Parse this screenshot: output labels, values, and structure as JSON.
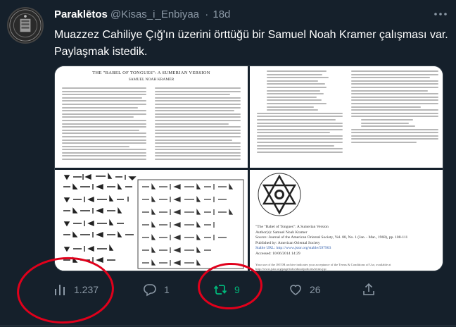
{
  "tweet": {
    "author_name": "Paraklētos",
    "author_handle": "@Kisas_i_Enbiyaa",
    "separator": "·",
    "time": "18d",
    "text": "Muazzez Cahiliye Çığ'ın üzerini örttüğü bir Samuel Noah Kramer çalışması var. Paylaşmak istedik."
  },
  "media": {
    "page1": {
      "title": "THE \"BABEL OF TONGUES\": A SUMERIAN VERSION",
      "author": "SAMUEL NOAH KRAMER"
    },
    "page4": {
      "lines": [
        "\"The \"Babel of Tongues\": A Sumerian Version",
        "Author(s): Samuel Noah Kramer",
        "Source: Journal of the American Oriental Society, Vol. 88, No. 1 (Jan. - Mar., 1968), pp. 108-111",
        "Published by: American Oriental Society",
        "Stable URL: http://www.jstor.org/stable/597903",
        "Accessed: 10/06/2014 14:29"
      ],
      "footer": "Your use of the JSTOR archive indicates your acceptance of the Terms & Conditions of Use, available at http://www.jstor.org/page/info/about/policies/terms.jsp"
    }
  },
  "actions": {
    "views": "1.237",
    "replies": "1",
    "retweets": "9",
    "likes": "26"
  },
  "icons": {
    "views": "bar-chart-icon",
    "reply": "speech-bubble-icon",
    "retweet": "retweet-icon",
    "like": "heart-icon",
    "share": "share-icon",
    "more": "more-dots-icon"
  },
  "colors": {
    "background": "#15202b",
    "muted_text": "#8b98a5",
    "retweet_active": "#00ba7c",
    "annotation_circle": "#e0001b"
  }
}
